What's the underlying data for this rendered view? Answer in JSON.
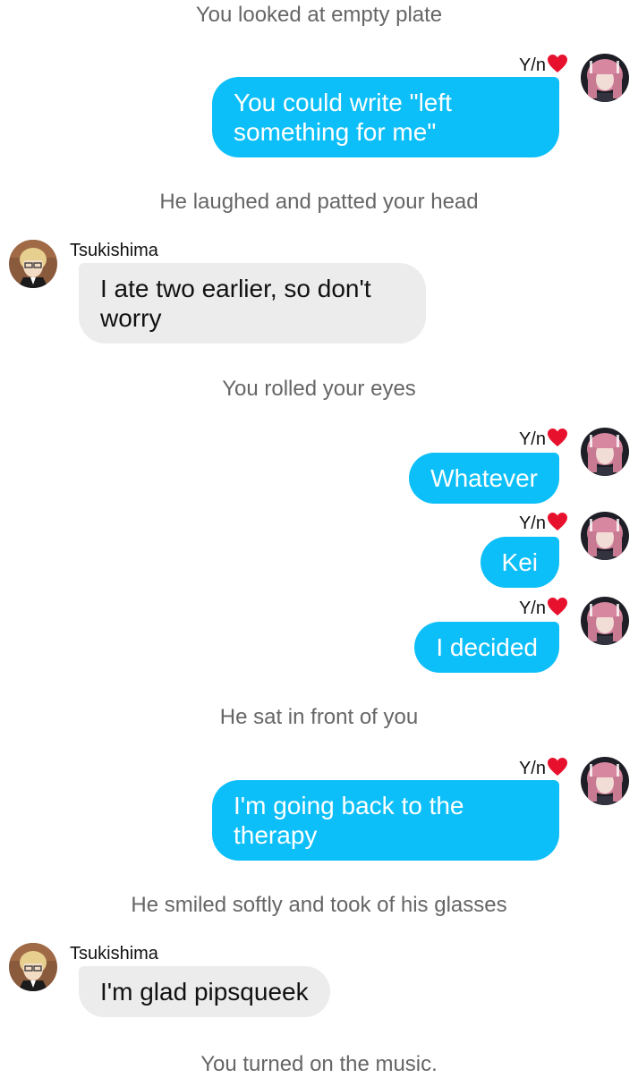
{
  "conversation": [
    {
      "type": "narration",
      "text": "You looked at empty plate"
    },
    {
      "type": "outgoing",
      "sender": "Y/n",
      "text": "You could write \"left something for me\""
    },
    {
      "type": "narration",
      "text": "He laughed and patted your head"
    },
    {
      "type": "incoming",
      "sender": "Tsukishima",
      "text": "I ate two earlier, so don't worry"
    },
    {
      "type": "narration",
      "text": "You rolled your eyes"
    },
    {
      "type": "outgoing",
      "sender": "Y/n",
      "text": "Whatever"
    },
    {
      "type": "outgoing",
      "sender": "Y/n",
      "text": "Kei"
    },
    {
      "type": "outgoing",
      "sender": "Y/n",
      "text": "I decided"
    },
    {
      "type": "narration",
      "text": "He sat in front of you"
    },
    {
      "type": "outgoing",
      "sender": "Y/n",
      "text": "I'm going back to the therapy"
    },
    {
      "type": "narration",
      "text": "He smiled softly and took of his glasses"
    },
    {
      "type": "incoming",
      "sender": "Tsukishima",
      "text": "I'm glad pipsqueek"
    },
    {
      "type": "narration",
      "text": "You turned on the music."
    }
  ],
  "colors": {
    "outgoing_bubble": "#0dbff8",
    "incoming_bubble": "#ececec",
    "narration_text": "#666666",
    "heart": "#e8112d"
  },
  "icons": {
    "sender_suffix": "red-heart-icon",
    "outgoing_avatar": "pink-haired-avatar",
    "incoming_avatar": "blond-glasses-avatar"
  }
}
